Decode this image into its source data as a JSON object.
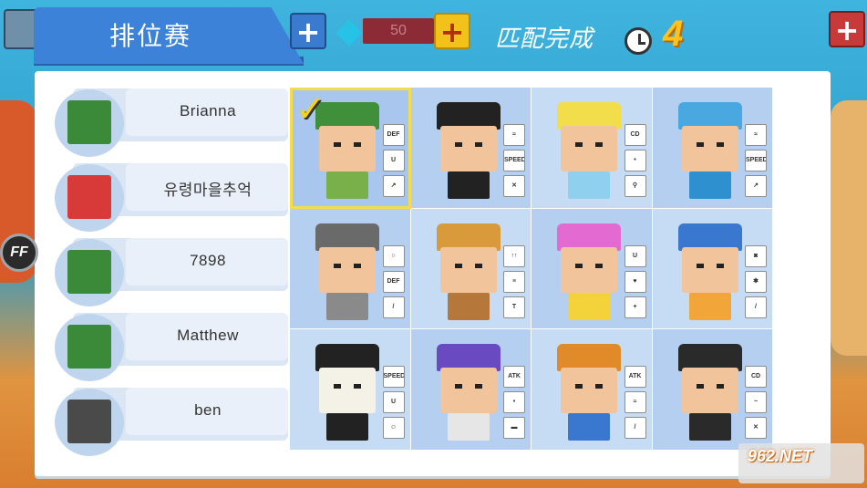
{
  "header": {
    "title": "排位赛",
    "gem_count": "50",
    "match_status": "匹配完成",
    "countdown": "4",
    "ff_label": "FF"
  },
  "players": [
    {
      "name": "Brianna",
      "avatar": "robin-hood-avatar",
      "color": "#3a8a3a"
    },
    {
      "name": "유령마을추억",
      "avatar": "monkey-king-avatar",
      "color": "#d83a3a"
    },
    {
      "name": "7898",
      "avatar": "robin-hood-avatar",
      "color": "#3a8a3a"
    },
    {
      "name": "Matthew",
      "avatar": "robin-hood-avatar",
      "color": "#3a8a3a"
    },
    {
      "name": "ben",
      "avatar": "knight-avatar",
      "color": "#4a4a4a"
    }
  ],
  "characters": [
    {
      "id": "robin-hood",
      "hat": "#3f8f3b",
      "face": "#f2c49b",
      "body": "#7ab04a",
      "selected": true,
      "skills": [
        "DEF",
        "U",
        "↗"
      ]
    },
    {
      "id": "ninja",
      "hat": "#222222",
      "face": "#f2c49b",
      "body": "#222222",
      "selected": false,
      "skills": [
        "≈",
        "SPEED",
        "✕"
      ]
    },
    {
      "id": "cool-guy",
      "hat": "#f2dd4a",
      "face": "#f2c49b",
      "body": "#8fd0ef",
      "selected": false,
      "skills": [
        "CD",
        "•",
        "⚲"
      ]
    },
    {
      "id": "blue-hood",
      "hat": "#4aa8e0",
      "face": "#f2c49b",
      "body": "#2f90d0",
      "selected": false,
      "skills": [
        "≈",
        "SPEED",
        "↗"
      ]
    },
    {
      "id": "knight",
      "hat": "#6a6a6a",
      "face": "#f2c49b",
      "body": "#8a8a8a",
      "selected": false,
      "skills": [
        "○",
        "DEF",
        "/"
      ]
    },
    {
      "id": "sheriff",
      "hat": "#d89a3a",
      "face": "#f2c49b",
      "body": "#b5783a",
      "selected": false,
      "skills": [
        "↑↑",
        "≡",
        "T"
      ]
    },
    {
      "id": "pink-girl",
      "hat": "#e26ad0",
      "face": "#f2c49b",
      "body": "#f4d23a",
      "selected": false,
      "skills": [
        "U",
        "♥",
        "+"
      ]
    },
    {
      "id": "spartan",
      "hat": "#3a78d0",
      "face": "#f2c49b",
      "body": "#f2a63a",
      "selected": false,
      "skills": [
        "◙",
        "✱",
        "/"
      ]
    },
    {
      "id": "masked",
      "hat": "#222222",
      "face": "#f4f1e6",
      "body": "#222222",
      "selected": false,
      "skills": [
        "SPEED",
        "U",
        "☺"
      ]
    },
    {
      "id": "wizard",
      "hat": "#6a4ac0",
      "face": "#f2c49b",
      "body": "#e6e6e6",
      "selected": false,
      "skills": [
        "ATK",
        "•",
        "▬"
      ]
    },
    {
      "id": "visor",
      "hat": "#e08a2a",
      "face": "#f2c49b",
      "body": "#3a78d0",
      "selected": false,
      "skills": [
        "ATK",
        "≈",
        "/"
      ]
    },
    {
      "id": "bat-hero",
      "hat": "#2a2a2a",
      "face": "#f2c49b",
      "body": "#2a2a2a",
      "selected": false,
      "skills": [
        "CD",
        "~",
        "✕"
      ]
    }
  ],
  "watermark": "962.NET"
}
